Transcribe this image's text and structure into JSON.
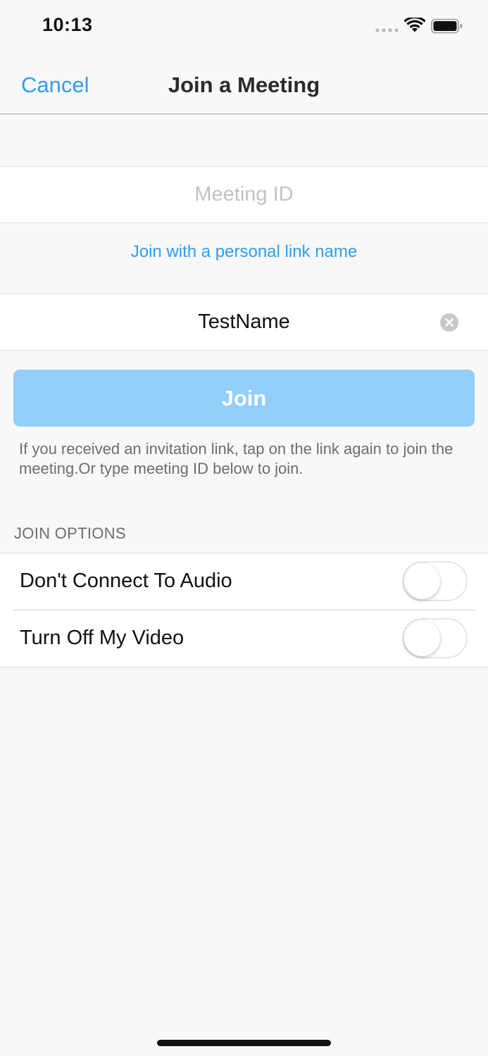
{
  "status_bar": {
    "time": "10:13",
    "icons": [
      "signal-dots-icon",
      "wifi-icon",
      "battery-icon"
    ]
  },
  "nav": {
    "cancel_label": "Cancel",
    "title": "Join a Meeting"
  },
  "form": {
    "meeting_id": {
      "placeholder": "Meeting ID",
      "value": ""
    },
    "personal_link_label": "Join with a personal link name",
    "name": {
      "value": "TestName",
      "clear_icon": "clear-icon"
    },
    "join_label": "Join",
    "hint": "If you received an invitation link, tap on the link again to join the meeting.Or type meeting ID below to join."
  },
  "join_options": {
    "header": "JOIN OPTIONS",
    "items": [
      {
        "label": "Don't Connect To Audio",
        "enabled": false
      },
      {
        "label": "Turn Off My Video",
        "enabled": false
      }
    ]
  },
  "colors": {
    "accent": "#2d9ff0",
    "join_button_disabled": "#92cef9",
    "background": "#f8f8f8"
  }
}
